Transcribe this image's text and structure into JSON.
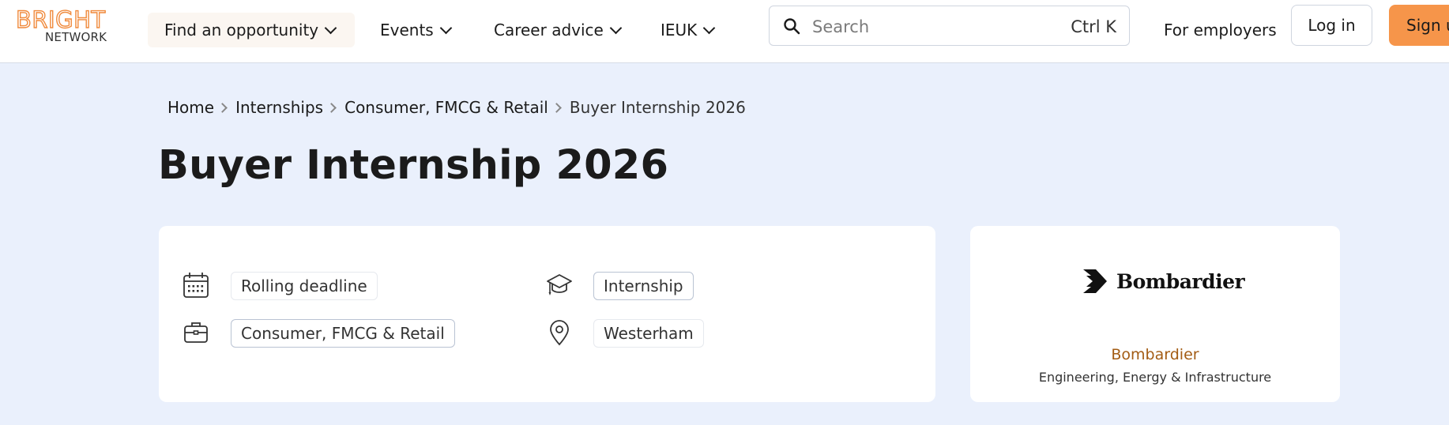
{
  "brand": {
    "top": "BRIGHT",
    "bottom": "NETWORK",
    "accent_color": "#f08a3c"
  },
  "nav": {
    "items": [
      {
        "label": "Find an opportunity"
      },
      {
        "label": "Events"
      },
      {
        "label": "Career advice"
      },
      {
        "label": "IEUK"
      }
    ]
  },
  "search": {
    "placeholder": "Search",
    "shortcut": "Ctrl K"
  },
  "header_actions": {
    "employers": "For employers",
    "login": "Log in",
    "signup": "Sign up",
    "signup_color": "#f6954a"
  },
  "breadcrumb": [
    "Home",
    "Internships",
    "Consumer, FMCG & Retail",
    "Buyer Internship 2026"
  ],
  "page": {
    "title": "Buyer Internship 2026",
    "background": "#eaf0fc"
  },
  "details": {
    "deadline": {
      "icon": "calendar-icon",
      "label": "Rolling deadline"
    },
    "type": {
      "icon": "graduation-cap-icon",
      "label": "Internship"
    },
    "sector": {
      "icon": "briefcase-icon",
      "label": "Consumer, FMCG & Retail"
    },
    "location": {
      "icon": "map-pin-icon",
      "label": "Westerham"
    }
  },
  "company": {
    "logo_text": "Bombardier",
    "name": "Bombardier",
    "sector": "Engineering, Energy & Infrastructure",
    "name_color": "#a35c14"
  }
}
